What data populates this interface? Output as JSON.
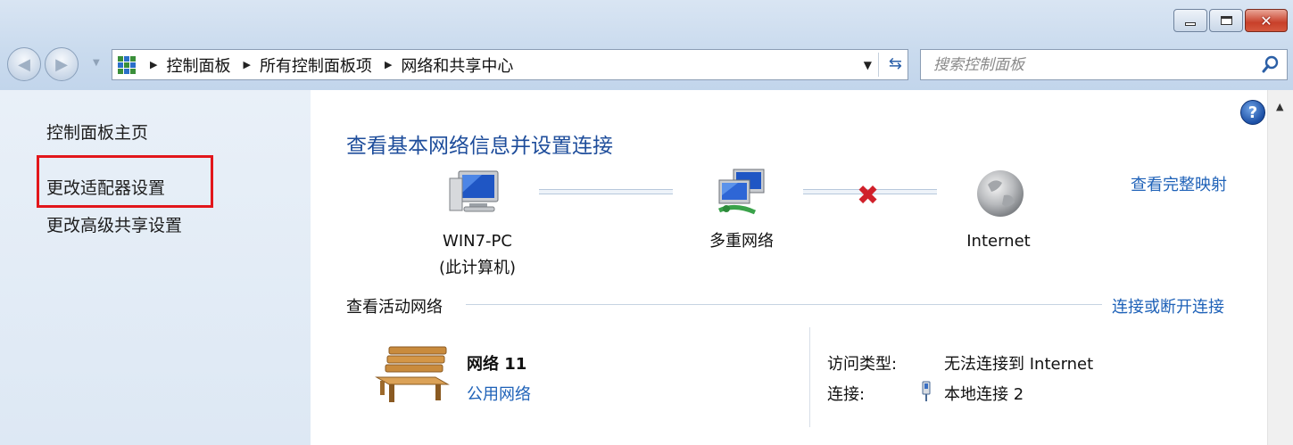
{
  "window": {
    "buttons": {
      "minimize": "minimize",
      "maximize": "maximize",
      "close": "close"
    }
  },
  "nav": {
    "breadcrumbs": [
      "控制面板",
      "所有控制面板项",
      "网络和共享中心"
    ],
    "search_placeholder": "搜索控制面板"
  },
  "sidebar": {
    "items": [
      {
        "label": "控制面板主页"
      },
      {
        "label": "更改适配器设置",
        "highlighted": true
      },
      {
        "label": "更改高级共享设置"
      }
    ]
  },
  "main": {
    "title": "查看基本网络信息并设置连接",
    "map_link": "查看完整映射",
    "nodes": {
      "computer_name": "WIN7-PC",
      "computer_sub": "(此计算机)",
      "network": "多重网络",
      "internet": "Internet"
    },
    "active_networks_title": "查看活动网络",
    "connect_link": "连接或断开连接",
    "network": {
      "name": "网络  11",
      "type": "公用网络",
      "access_label": "访问类型:",
      "access_value": "无法连接到 Internet",
      "connection_label": "连接:",
      "connection_value": "本地连接 2"
    }
  },
  "colors": {
    "link": "#1f62b8",
    "title": "#1e4d9b",
    "highlight_box": "#e2161b",
    "error_x": "#d0202a"
  }
}
